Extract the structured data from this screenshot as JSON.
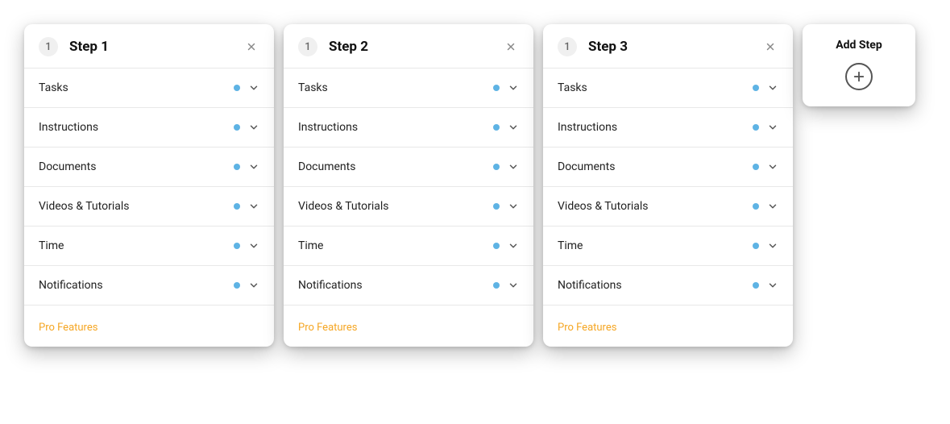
{
  "steps": [
    {
      "number": "1",
      "title": "Step 1",
      "sections": [
        {
          "label": "Tasks"
        },
        {
          "label": "Instructions"
        },
        {
          "label": "Documents"
        },
        {
          "label": "Videos & Tutorials"
        },
        {
          "label": "Time"
        },
        {
          "label": "Notifications"
        }
      ],
      "pro_label": "Pro Features"
    },
    {
      "number": "1",
      "title": "Step 2",
      "sections": [
        {
          "label": "Tasks"
        },
        {
          "label": "Instructions"
        },
        {
          "label": "Documents"
        },
        {
          "label": "Videos & Tutorials"
        },
        {
          "label": "Time"
        },
        {
          "label": "Notifications"
        }
      ],
      "pro_label": "Pro Features"
    },
    {
      "number": "1",
      "title": "Step 3",
      "sections": [
        {
          "label": "Tasks"
        },
        {
          "label": "Instructions"
        },
        {
          "label": "Documents"
        },
        {
          "label": "Videos & Tutorials"
        },
        {
          "label": "Time"
        },
        {
          "label": "Notifications"
        }
      ],
      "pro_label": "Pro Features"
    }
  ],
  "add_step": {
    "label": "Add Step"
  }
}
